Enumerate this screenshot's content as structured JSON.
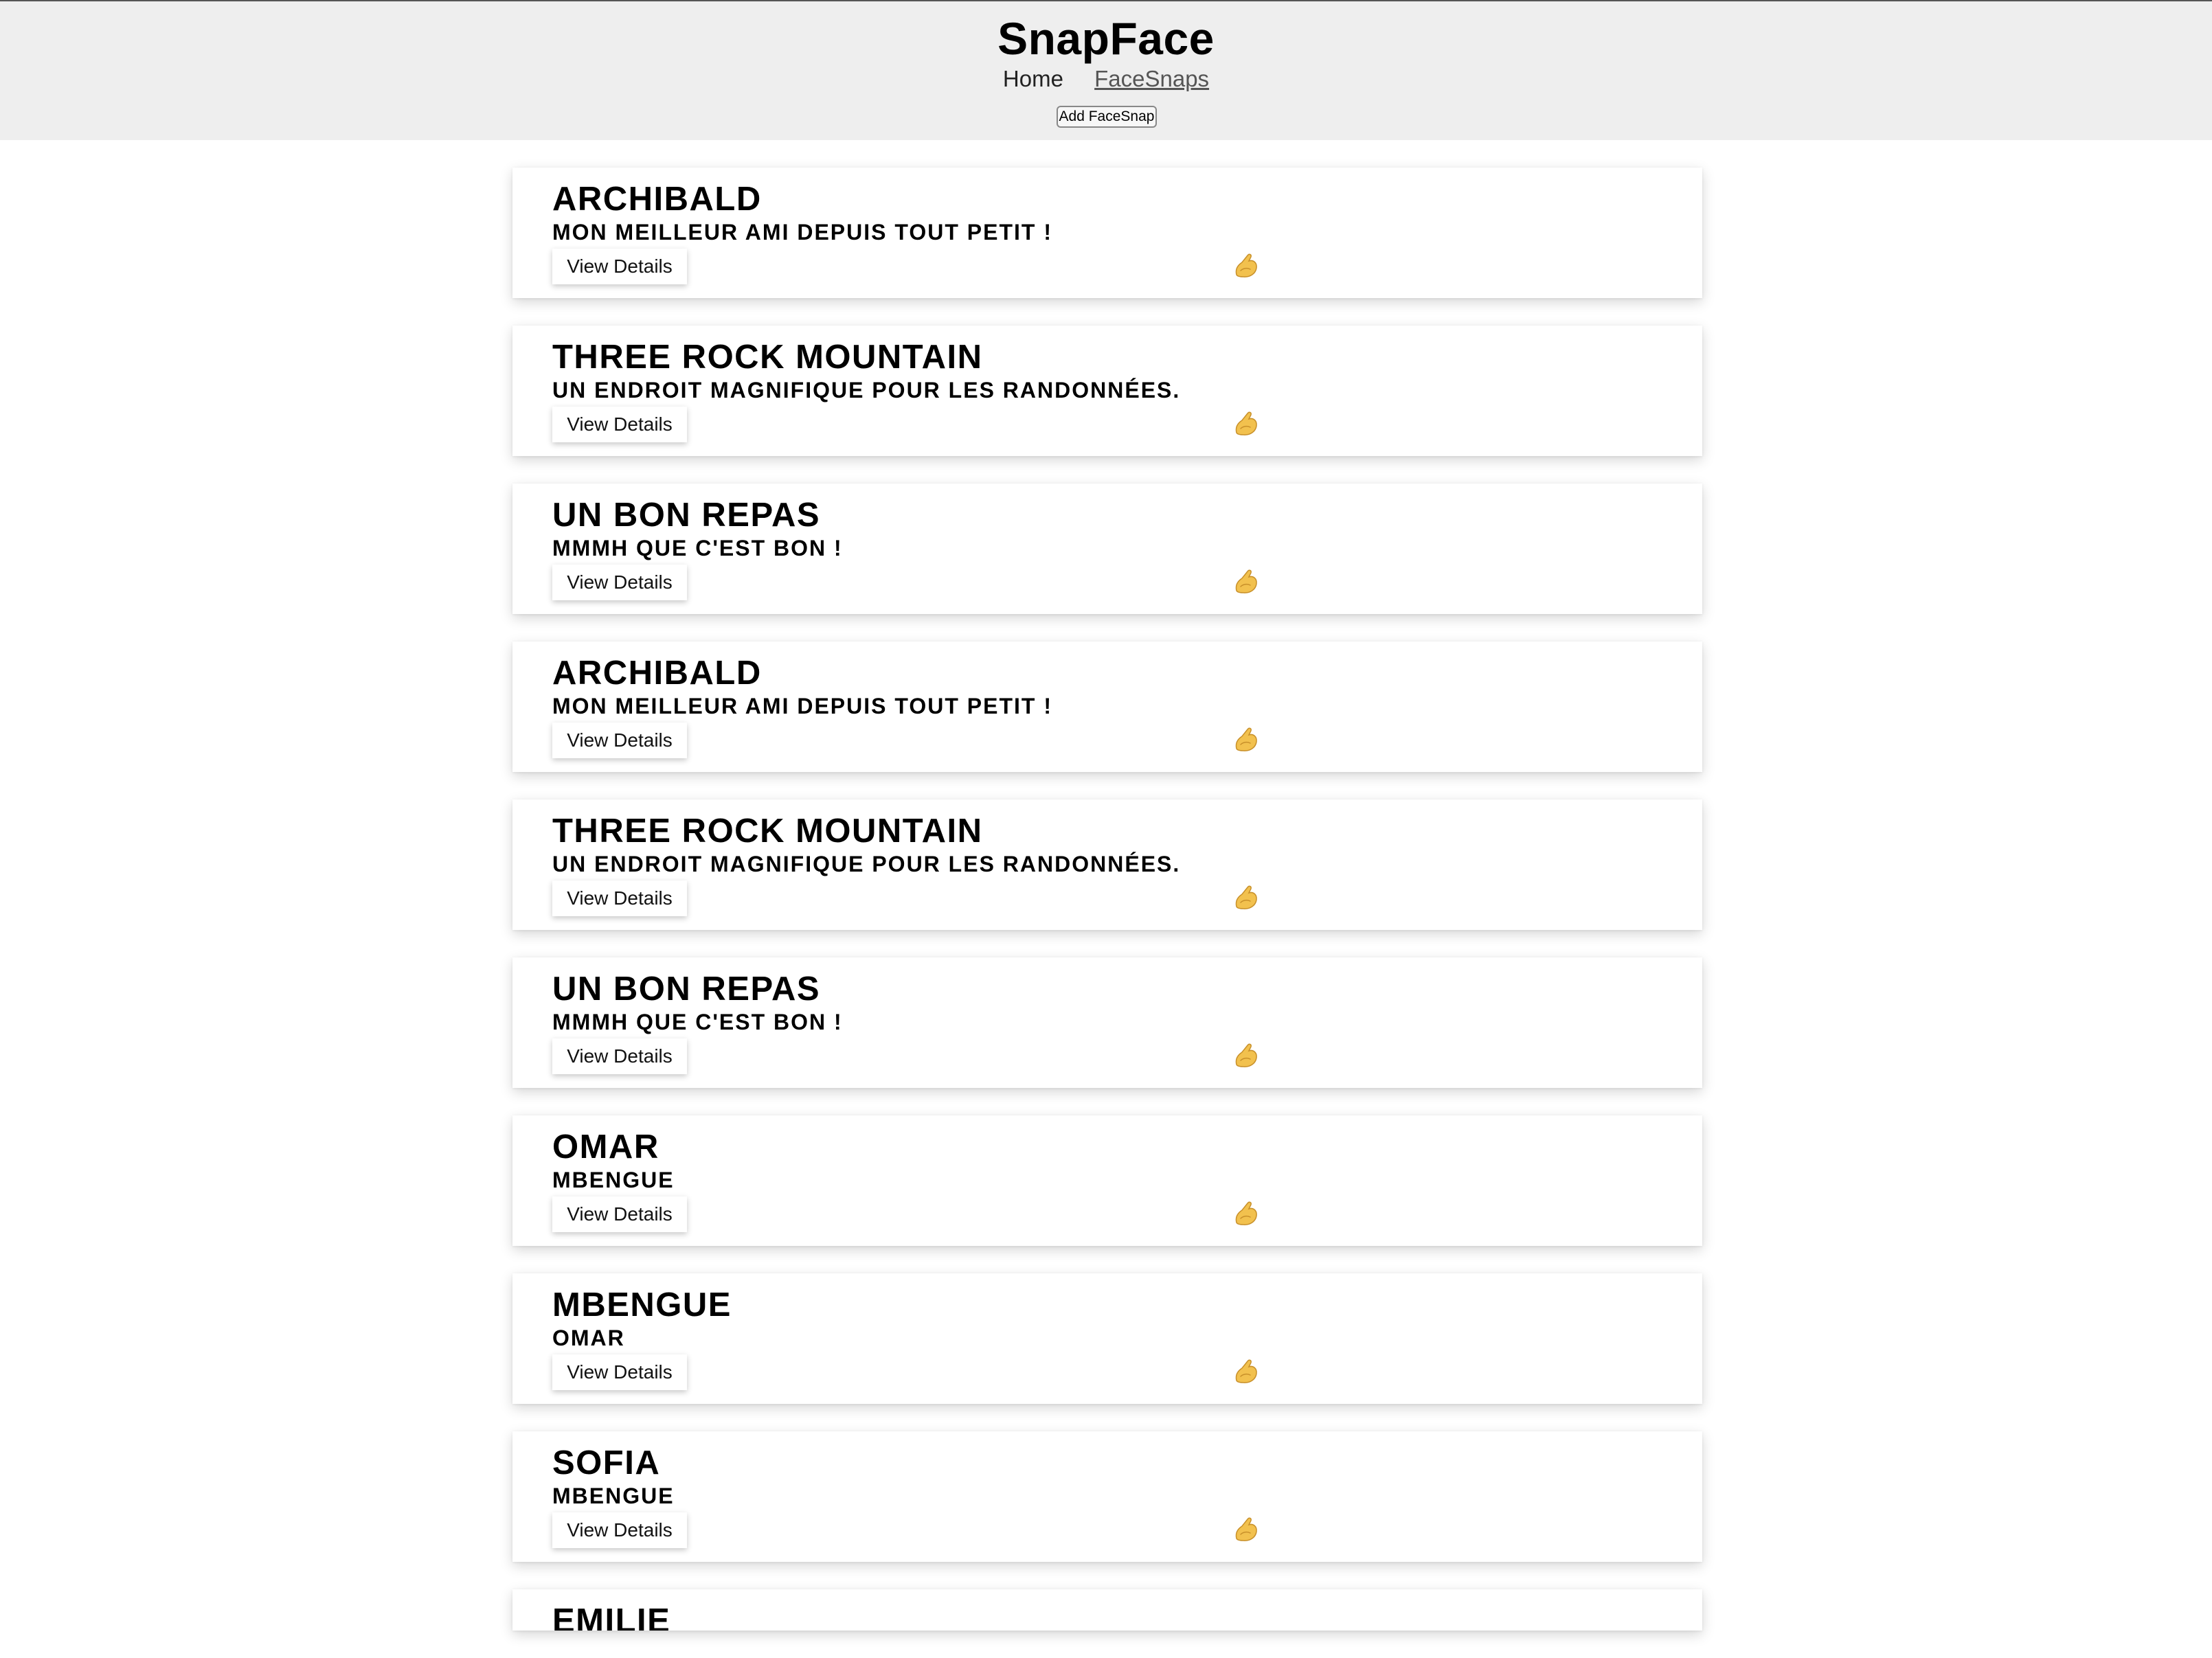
{
  "header": {
    "title": "SnapFace",
    "nav": [
      {
        "label": "Home"
      },
      {
        "label": "FaceSnaps"
      }
    ],
    "add_button_label": "Add FaceSnap"
  },
  "cards": [
    {
      "title": "ARCHIBALD",
      "subtitle": "MON MEILLEUR AMI DEPUIS TOUT PETIT !",
      "button": "View Details",
      "icon": "snap-hand-icon"
    },
    {
      "title": "THREE ROCK MOUNTAIN",
      "subtitle": "UN ENDROIT MAGNIFIQUE POUR LES RANDONNÉES.",
      "button": "View Details",
      "icon": "snap-hand-icon"
    },
    {
      "title": "UN BON REPAS",
      "subtitle": "MMMH QUE C'EST BON !",
      "button": "View Details",
      "icon": "snap-hand-icon"
    },
    {
      "title": "ARCHIBALD",
      "subtitle": "MON MEILLEUR AMI DEPUIS TOUT PETIT !",
      "button": "View Details",
      "icon": "snap-hand-icon"
    },
    {
      "title": "THREE ROCK MOUNTAIN",
      "subtitle": "UN ENDROIT MAGNIFIQUE POUR LES RANDONNÉES.",
      "button": "View Details",
      "icon": "snap-hand-icon"
    },
    {
      "title": "UN BON REPAS",
      "subtitle": "MMMH QUE C'EST BON !",
      "button": "View Details",
      "icon": "snap-hand-icon"
    },
    {
      "title": "OMAR",
      "subtitle": "MBENGUE",
      "button": "View Details",
      "icon": "snap-hand-icon"
    },
    {
      "title": "MBENGUE",
      "subtitle": "OMAR",
      "button": "View Details",
      "icon": "snap-hand-icon"
    },
    {
      "title": "SOFIA",
      "subtitle": "MBENGUE",
      "button": "View Details",
      "icon": "snap-hand-icon"
    },
    {
      "title": "EMILIE",
      "subtitle": "",
      "button": "",
      "icon": ""
    }
  ],
  "colors": {
    "header_bg": "#eeeeee",
    "page_bg": "#ffffff",
    "icon_fill": "#f2c14e"
  }
}
